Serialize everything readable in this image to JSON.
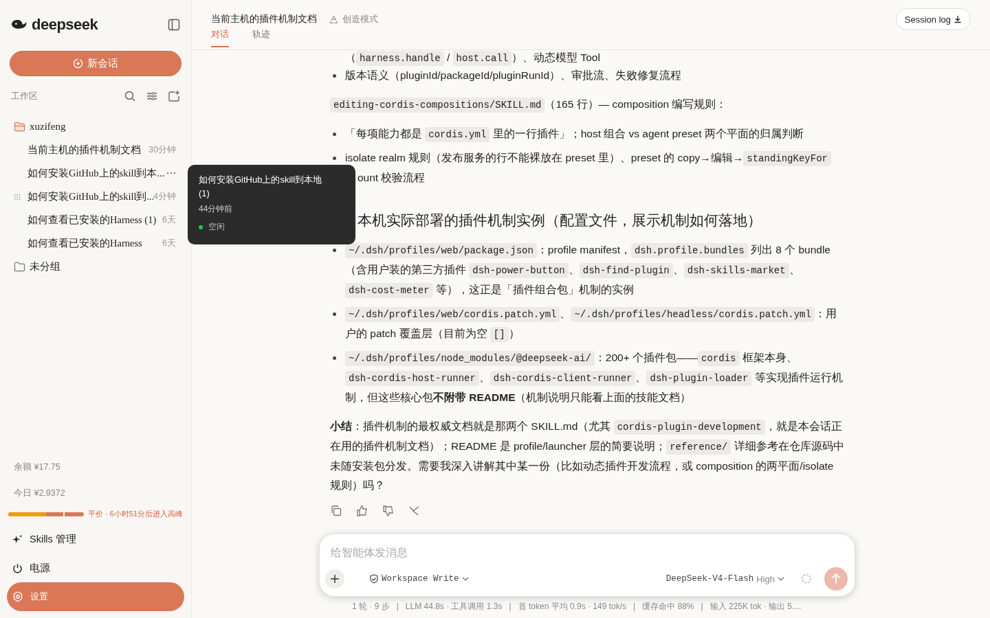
{
  "sidebar": {
    "brand": "deepseek",
    "new_chat": "新会话",
    "workspace_label": "工作区",
    "groups": [
      {
        "name": "xuzifeng",
        "expanded": true,
        "sessions": [
          {
            "title": "当前主机的插件机制文档",
            "time": "30分钟",
            "hovered": false,
            "running": false
          },
          {
            "title": "如何安装GitHub上的skill到本...",
            "hovered": true,
            "running": false
          },
          {
            "title": "如何安装GitHub上的skill到...",
            "time": "4分钟",
            "hovered": false,
            "running": true
          },
          {
            "title": "如何查看已安装的Harness (1)",
            "time": "6天",
            "hovered": false,
            "running": false
          },
          {
            "title": "如何查看已安装的Harness",
            "time": "6天",
            "hovered": false,
            "running": false
          }
        ]
      },
      {
        "name": "未分组",
        "expanded": false
      }
    ],
    "balance": "余额  ¥17.75",
    "today": "今日  ¥2.9372",
    "price": {
      "level": 0.5,
      "text": "平价 · 6小时51分后进入高峰"
    },
    "menu": [
      {
        "kind": "skills",
        "label": "Skills 管理",
        "selected": false
      },
      {
        "kind": "power",
        "label": "电源",
        "selected": false
      },
      {
        "kind": "settings",
        "label": "设置",
        "selected": true
      }
    ]
  },
  "tooltip": {
    "title": "如何安装GitHub上的skill到本地 (1)",
    "time": "44分钟前",
    "status": "空闲",
    "color": "#22c55e"
  },
  "header": {
    "title": "当前主机的插件机制文档",
    "mode": "创造模式",
    "tabs": [
      {
        "label": "对话",
        "selected": true
      },
      {
        "label": "轨迹",
        "selected": false
      }
    ],
    "session_log": "Session log"
  },
  "blocks": [
    {
      "kind": "line",
      "segments": [
        {
          "kind": "text",
          "text": "（"
        },
        {
          "kind": "code",
          "text": "harness.handle"
        },
        {
          "kind": "text",
          "text": " / "
        },
        {
          "kind": "code",
          "text": "host.call"
        },
        {
          "kind": "text",
          "text": "）、动态模型 Tool"
        }
      ]
    },
    {
      "kind": "bullet",
      "segments": [
        {
          "kind": "text",
          "text": "版本语义（pluginId/packageId/pluginRunId）、审批流、失败修复流程"
        }
      ]
    },
    {
      "kind": "para",
      "segments": [
        {
          "kind": "code",
          "text": "editing-cordis-compositions/SKILL.md"
        },
        {
          "kind": "text",
          "text": "（165 行）— composition 编写规则："
        }
      ]
    },
    {
      "kind": "bullet",
      "segments": [
        {
          "kind": "text",
          "text": "「每项能力都是 "
        },
        {
          "kind": "code",
          "text": "cordis.yml"
        },
        {
          "kind": "text",
          "text": " 里的一行插件」；host 组合 vs agent preset 两个平面的归属判断"
        }
      ]
    },
    {
      "kind": "bullet",
      "segments": [
        {
          "kind": "text",
          "text": "isolate realm 规则（发布服务的行不能裸放在 preset 里）、preset 的 copy→编辑→"
        },
        {
          "kind": "code",
          "text": "standingKeyFor"
        }
      ]
    },
    {
      "kind": "wrapped",
      "segments": [
        {
          "kind": "text",
          "text": "ount 校验流程"
        }
      ]
    },
    {
      "kind": "heading",
      "segments": [
        {
          "kind": "text",
          "text": "本机实际部署的插件机制实例（配置文件，展示机制如何落地）"
        }
      ]
    },
    {
      "kind": "bullet",
      "segments": [
        {
          "kind": "code",
          "text": "~/.dsh/profiles/web/package.json"
        },
        {
          "kind": "text",
          "text": "：profile manifest，"
        },
        {
          "kind": "code",
          "text": "dsh.profile.bundles"
        },
        {
          "kind": "text",
          "text": " 列出 8 个 bundle（含用户装的第三方插件 "
        },
        {
          "kind": "code",
          "text": "dsh-power-button"
        },
        {
          "kind": "text",
          "text": "、"
        },
        {
          "kind": "code",
          "text": "dsh-find-plugin"
        },
        {
          "kind": "text",
          "text": "、"
        },
        {
          "kind": "code",
          "text": "dsh-skills-market"
        },
        {
          "kind": "text",
          "text": "、"
        },
        {
          "kind": "code",
          "text": "dsh-cost-meter"
        },
        {
          "kind": "text",
          "text": " 等），这正是「插件组合包」机制的实例"
        }
      ]
    },
    {
      "kind": "bullet",
      "segments": [
        {
          "kind": "code",
          "text": "~/.dsh/profiles/web/cordis.patch.yml"
        },
        {
          "kind": "text",
          "text": "、"
        },
        {
          "kind": "code",
          "text": "~/.dsh/profiles/headless/cordis.patch.yml"
        },
        {
          "kind": "text",
          "text": "：用户的 patch 覆盖层（目前为空 "
        },
        {
          "kind": "code",
          "text": "[]"
        },
        {
          "kind": "text",
          "text": "）"
        }
      ]
    },
    {
      "kind": "bullet",
      "segments": [
        {
          "kind": "code",
          "text": "~/.dsh/profiles/node_modules/@deepseek-ai/"
        },
        {
          "kind": "text",
          "text": "：200+ 个插件包——"
        },
        {
          "kind": "code",
          "text": "cordis"
        },
        {
          "kind": "text",
          "text": " 框架本身、"
        },
        {
          "kind": "code",
          "text": "dsh-cordis-host-runner"
        },
        {
          "kind": "text",
          "text": "、"
        },
        {
          "kind": "code",
          "text": "dsh-cordis-client-runner"
        },
        {
          "kind": "text",
          "text": "、"
        },
        {
          "kind": "code",
          "text": "dsh-plugin-loader"
        },
        {
          "kind": "text",
          "text": " 等实现插件运行机制，但这些核心包"
        },
        {
          "kind": "bold",
          "text": "不附带 README"
        },
        {
          "kind": "text",
          "text": "（机制说明只能看上面的技能文档）"
        }
      ]
    },
    {
      "kind": "para",
      "segments": [
        {
          "kind": "bold",
          "text": "小结"
        },
        {
          "kind": "text",
          "text": "：插件机制的最权威文档就是那两个 SKILL.md（尤其 "
        },
        {
          "kind": "code",
          "text": "cordis-plugin-development"
        },
        {
          "kind": "text",
          "text": "，就是本会话正在用的插件机制文档）；README 是 profile/launcher 层的简要说明；"
        },
        {
          "kind": "code",
          "text": "reference/"
        },
        {
          "kind": "text",
          "text": " 详细参考在仓库源码中未随安装包分发。需要我深入讲解其中某一份（比如动态插件开发流程，或 composition 的两平面/isolate 规则）吗？"
        }
      ]
    }
  ],
  "composer": {
    "placeholder": "给智能体发消息",
    "permission": "Workspace Write",
    "model": "DeepSeek-V4-Flash",
    "effort": "High",
    "send_disabled": true
  },
  "stats": "1 轮 · 9 步   |   LLM 44.8s · 工具调用 1.3s   |   首 token 平均 0.9s · 149 tok/s   |   缓存命中 88%   |   输入 225K tok · 输出 5...."
}
